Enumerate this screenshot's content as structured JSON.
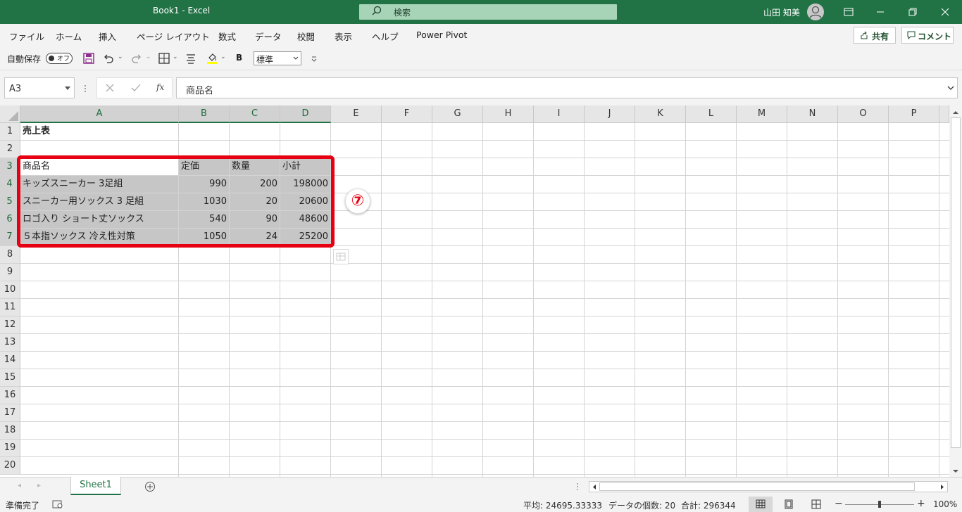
{
  "window": {
    "title": "Book1  -  Excel",
    "search_placeholder": "検索",
    "user_name": "山田 知美"
  },
  "menu": {
    "items": [
      "ファイル",
      "ホーム",
      "挿入",
      "ページ レイアウト",
      "数式",
      "データ",
      "校閲",
      "表示",
      "ヘルプ",
      "Power Pivot"
    ],
    "share": "共有",
    "comment": "コメント"
  },
  "qat": {
    "autosave_label": "自動保存",
    "autosave_state": "オフ",
    "bold": "B",
    "number_format": "標準"
  },
  "formula_bar": {
    "name_box": "A3",
    "fx": "fx",
    "content": "商品名"
  },
  "columns": [
    "A",
    "B",
    "C",
    "D",
    "E",
    "F",
    "G",
    "H",
    "I",
    "J",
    "K",
    "L",
    "M",
    "N",
    "O",
    "P"
  ],
  "rows": [
    "1",
    "2",
    "3",
    "4",
    "5",
    "6",
    "7",
    "8",
    "9",
    "10",
    "11",
    "12",
    "13",
    "14",
    "15",
    "16",
    "17",
    "18",
    "19",
    "20"
  ],
  "sheet": {
    "title": "売上表",
    "headers": [
      "商品名",
      "定価",
      "数量",
      "小計"
    ],
    "data": [
      [
        "キッズスニーカー 3足組",
        "990",
        "200",
        "198000"
      ],
      [
        "スニーカー用ソックス 3 足組",
        "1030",
        "20",
        "20600"
      ],
      [
        "ロゴ入り ショート丈ソックス",
        "540",
        "90",
        "48600"
      ],
      [
        "５本指ソックス 冷え性対策",
        "1050",
        "24",
        "25200"
      ]
    ]
  },
  "annotation": {
    "step": "⑦",
    "highlight_color": "#e60012"
  },
  "tabs": {
    "sheet1": "Sheet1"
  },
  "status": {
    "ready": "準備完了",
    "average": "平均: 24695.33333",
    "count": "データの個数: 20",
    "sum": "合計: 296344",
    "zoom": "100%"
  },
  "colors": {
    "excel_green": "#217346",
    "selection_gray": "#c6c6c6"
  }
}
